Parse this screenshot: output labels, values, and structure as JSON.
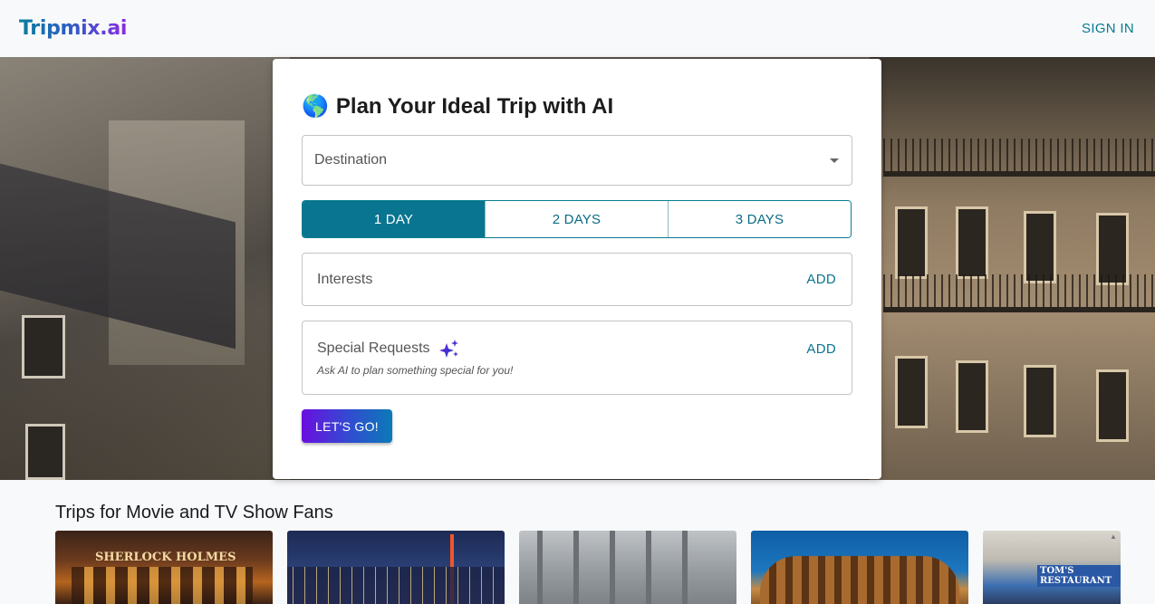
{
  "header": {
    "logo": "Tripmix.ai",
    "signin_label": "SIGN IN"
  },
  "planner": {
    "title": "Plan Your Ideal Trip with AI",
    "title_icon": "globe-emoji",
    "destination_label": "Destination",
    "days": [
      {
        "label": "1 DAY",
        "selected": true
      },
      {
        "label": "2 DAYS",
        "selected": false
      },
      {
        "label": "3 DAYS",
        "selected": false
      }
    ],
    "interests_label": "Interests",
    "interests_add": "ADD",
    "special_label": "Special Requests",
    "special_icon": "sparkle-icon",
    "special_add": "ADD",
    "special_hint": "Ask AI to plan something special for you!",
    "go_label": "LET'S GO!"
  },
  "section": {
    "title": "Trips for Movie and TV Show Fans",
    "cards": [
      {
        "sign": "SHERLOCK HOLMES"
      },
      {
        "sign": ""
      },
      {
        "sign": ""
      },
      {
        "sign": ""
      },
      {
        "sign": "TOM'S RESTAURANT"
      }
    ]
  },
  "colors": {
    "accent": "#0a7590",
    "go_gradient_start": "#6a0fe0",
    "go_gradient_end": "#0b7ab6"
  }
}
